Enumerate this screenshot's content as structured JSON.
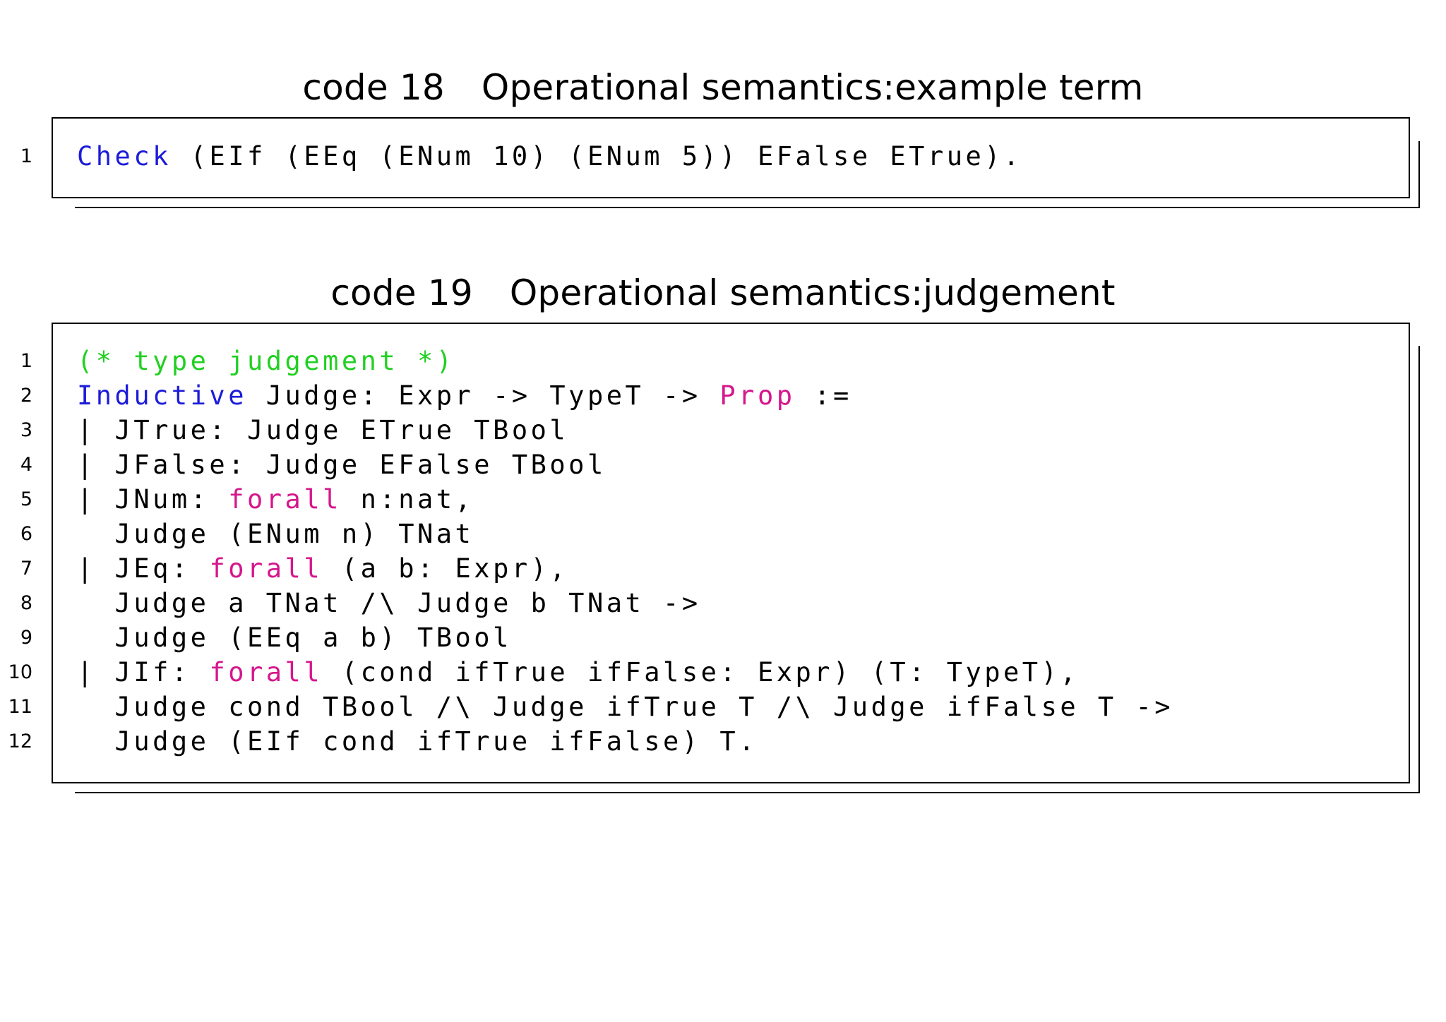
{
  "listings": [
    {
      "caption_number": "code 18",
      "caption_title": "Operational semantics:example term",
      "lines": [
        {
          "number": "1",
          "tokens": [
            {
              "text": "Check",
              "style": "keyword"
            },
            {
              "text": " (EIf (EEq (ENum 10) (ENum 5)) EFalse ETrue).",
              "style": "plain"
            }
          ]
        }
      ]
    },
    {
      "caption_number": "code 19",
      "caption_title": "Operational semantics:judgement",
      "lines": [
        {
          "number": "1",
          "tokens": [
            {
              "text": "(* type judgement *)",
              "style": "comment"
            }
          ]
        },
        {
          "number": "2",
          "tokens": [
            {
              "text": "Inductive",
              "style": "keyword"
            },
            {
              "text": " Judge: Expr -> TypeT -> ",
              "style": "plain"
            },
            {
              "text": "Prop",
              "style": "type"
            },
            {
              "text": " :=",
              "style": "plain"
            }
          ]
        },
        {
          "number": "3",
          "tokens": [
            {
              "text": "| JTrue: Judge ETrue TBool",
              "style": "plain"
            }
          ]
        },
        {
          "number": "4",
          "tokens": [
            {
              "text": "| JFalse: Judge EFalse TBool",
              "style": "plain"
            }
          ]
        },
        {
          "number": "5",
          "tokens": [
            {
              "text": "| JNum: ",
              "style": "plain"
            },
            {
              "text": "forall",
              "style": "type"
            },
            {
              "text": " n:nat,",
              "style": "plain"
            }
          ]
        },
        {
          "number": "6",
          "tokens": [
            {
              "text": "  Judge (ENum n) TNat",
              "style": "plain"
            }
          ]
        },
        {
          "number": "7",
          "tokens": [
            {
              "text": "| JEq: ",
              "style": "plain"
            },
            {
              "text": "forall",
              "style": "type"
            },
            {
              "text": " (a b: Expr),",
              "style": "plain"
            }
          ]
        },
        {
          "number": "8",
          "tokens": [
            {
              "text": "  Judge a TNat /\\ Judge b TNat ->",
              "style": "plain"
            }
          ]
        },
        {
          "number": "9",
          "tokens": [
            {
              "text": "  Judge (EEq a b) TBool",
              "style": "plain"
            }
          ]
        },
        {
          "number": "10",
          "tokens": [
            {
              "text": "| JIf: ",
              "style": "plain"
            },
            {
              "text": "forall",
              "style": "type"
            },
            {
              "text": " (cond ifTrue ifFalse: Expr) (T: TypeT),",
              "style": "plain"
            }
          ]
        },
        {
          "number": "11",
          "tokens": [
            {
              "text": "  Judge cond TBool /\\ Judge ifTrue T /\\ Judge ifFalse T ->",
              "style": "plain"
            }
          ]
        },
        {
          "number": "12",
          "tokens": [
            {
              "text": "  Judge (EIf cond ifTrue ifFalse) T.",
              "style": "plain"
            }
          ]
        }
      ]
    }
  ],
  "colors": {
    "keyword": "#1c1cd9",
    "type": "#d6168c",
    "comment": "#22d022",
    "plain": "#000000"
  }
}
